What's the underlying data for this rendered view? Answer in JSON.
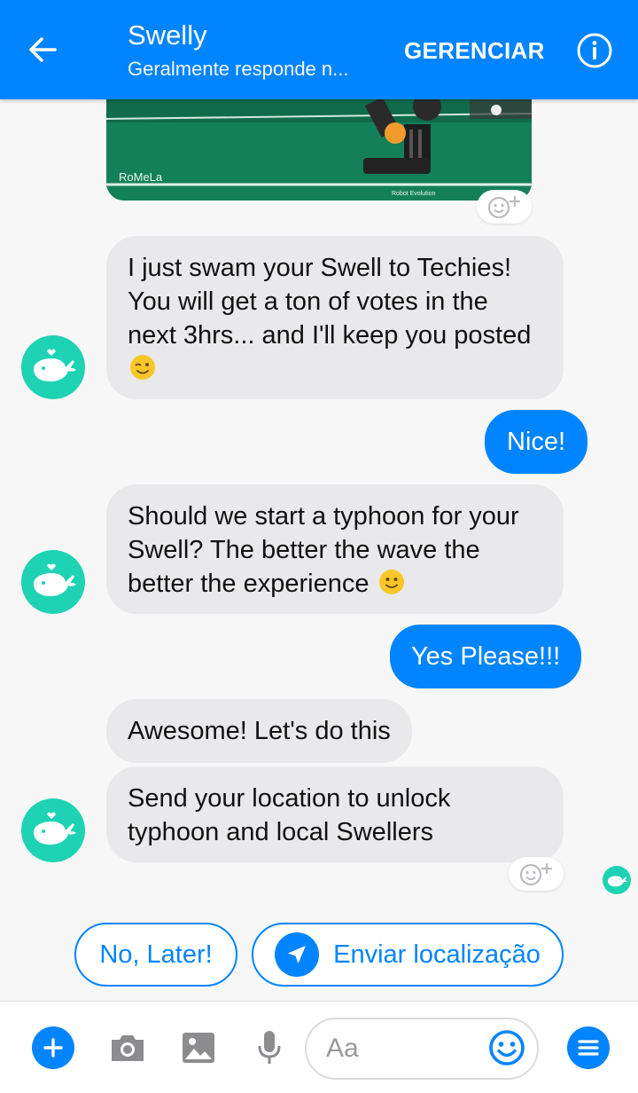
{
  "colors": {
    "accent": "#0084ff",
    "teal": "#1dd3b3"
  },
  "header": {
    "title": "Swelly",
    "subtitle": "Geralmente responde n...",
    "manage_label": "GERENCIAR"
  },
  "shared_image": {
    "watermark": "RoMeLa",
    "caption": "Robot Evolution"
  },
  "messages": [
    {
      "from": "bot",
      "text": "I just swam your Swell to Techies! You will get a ton of votes in the next 3hrs... and I'll keep you posted",
      "emoji": "winking-face"
    },
    {
      "from": "me",
      "text": "Nice!"
    },
    {
      "from": "bot",
      "text": "Should we start a typhoon for your Swell? The better the wave the better the experience",
      "emoji": "smiling-face"
    },
    {
      "from": "me",
      "text": "Yes Please!!!"
    },
    {
      "from": "bot",
      "text": "Awesome! Let's do this"
    },
    {
      "from": "bot",
      "text": "Send your location to unlock typhoon and local Swellers"
    }
  ],
  "quick_replies": [
    {
      "label": "No, Later!"
    },
    {
      "label": "Enviar localização",
      "icon": "location-arrow-icon"
    }
  ],
  "composer": {
    "placeholder": "Aa",
    "icons": [
      "plus-icon",
      "camera-icon",
      "image-icon",
      "microphone-icon",
      "emoji-icon",
      "menu-icon"
    ]
  }
}
